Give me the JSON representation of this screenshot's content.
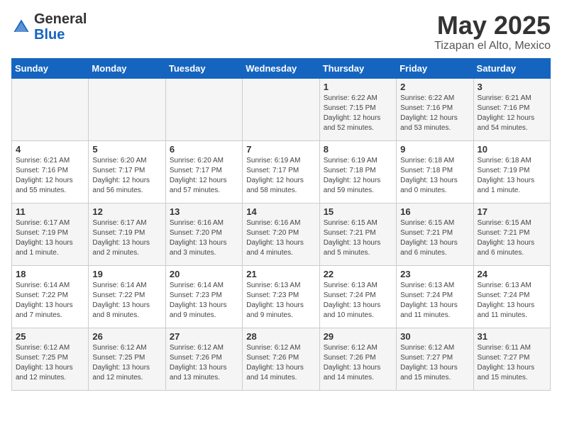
{
  "header": {
    "logo_general": "General",
    "logo_blue": "Blue",
    "title": "May 2025",
    "subtitle": "Tizapan el Alto, Mexico"
  },
  "weekdays": [
    "Sunday",
    "Monday",
    "Tuesday",
    "Wednesday",
    "Thursday",
    "Friday",
    "Saturday"
  ],
  "weeks": [
    [
      {
        "day": "",
        "info": ""
      },
      {
        "day": "",
        "info": ""
      },
      {
        "day": "",
        "info": ""
      },
      {
        "day": "",
        "info": ""
      },
      {
        "day": "1",
        "info": "Sunrise: 6:22 AM\nSunset: 7:15 PM\nDaylight: 12 hours and 52 minutes."
      },
      {
        "day": "2",
        "info": "Sunrise: 6:22 AM\nSunset: 7:16 PM\nDaylight: 12 hours and 53 minutes."
      },
      {
        "day": "3",
        "info": "Sunrise: 6:21 AM\nSunset: 7:16 PM\nDaylight: 12 hours and 54 minutes."
      }
    ],
    [
      {
        "day": "4",
        "info": "Sunrise: 6:21 AM\nSunset: 7:16 PM\nDaylight: 12 hours and 55 minutes."
      },
      {
        "day": "5",
        "info": "Sunrise: 6:20 AM\nSunset: 7:17 PM\nDaylight: 12 hours and 56 minutes."
      },
      {
        "day": "6",
        "info": "Sunrise: 6:20 AM\nSunset: 7:17 PM\nDaylight: 12 hours and 57 minutes."
      },
      {
        "day": "7",
        "info": "Sunrise: 6:19 AM\nSunset: 7:17 PM\nDaylight: 12 hours and 58 minutes."
      },
      {
        "day": "8",
        "info": "Sunrise: 6:19 AM\nSunset: 7:18 PM\nDaylight: 12 hours and 59 minutes."
      },
      {
        "day": "9",
        "info": "Sunrise: 6:18 AM\nSunset: 7:18 PM\nDaylight: 13 hours and 0 minutes."
      },
      {
        "day": "10",
        "info": "Sunrise: 6:18 AM\nSunset: 7:19 PM\nDaylight: 13 hours and 1 minute."
      }
    ],
    [
      {
        "day": "11",
        "info": "Sunrise: 6:17 AM\nSunset: 7:19 PM\nDaylight: 13 hours and 1 minute."
      },
      {
        "day": "12",
        "info": "Sunrise: 6:17 AM\nSunset: 7:19 PM\nDaylight: 13 hours and 2 minutes."
      },
      {
        "day": "13",
        "info": "Sunrise: 6:16 AM\nSunset: 7:20 PM\nDaylight: 13 hours and 3 minutes."
      },
      {
        "day": "14",
        "info": "Sunrise: 6:16 AM\nSunset: 7:20 PM\nDaylight: 13 hours and 4 minutes."
      },
      {
        "day": "15",
        "info": "Sunrise: 6:15 AM\nSunset: 7:21 PM\nDaylight: 13 hours and 5 minutes."
      },
      {
        "day": "16",
        "info": "Sunrise: 6:15 AM\nSunset: 7:21 PM\nDaylight: 13 hours and 6 minutes."
      },
      {
        "day": "17",
        "info": "Sunrise: 6:15 AM\nSunset: 7:21 PM\nDaylight: 13 hours and 6 minutes."
      }
    ],
    [
      {
        "day": "18",
        "info": "Sunrise: 6:14 AM\nSunset: 7:22 PM\nDaylight: 13 hours and 7 minutes."
      },
      {
        "day": "19",
        "info": "Sunrise: 6:14 AM\nSunset: 7:22 PM\nDaylight: 13 hours and 8 minutes."
      },
      {
        "day": "20",
        "info": "Sunrise: 6:14 AM\nSunset: 7:23 PM\nDaylight: 13 hours and 9 minutes."
      },
      {
        "day": "21",
        "info": "Sunrise: 6:13 AM\nSunset: 7:23 PM\nDaylight: 13 hours and 9 minutes."
      },
      {
        "day": "22",
        "info": "Sunrise: 6:13 AM\nSunset: 7:24 PM\nDaylight: 13 hours and 10 minutes."
      },
      {
        "day": "23",
        "info": "Sunrise: 6:13 AM\nSunset: 7:24 PM\nDaylight: 13 hours and 11 minutes."
      },
      {
        "day": "24",
        "info": "Sunrise: 6:13 AM\nSunset: 7:24 PM\nDaylight: 13 hours and 11 minutes."
      }
    ],
    [
      {
        "day": "25",
        "info": "Sunrise: 6:12 AM\nSunset: 7:25 PM\nDaylight: 13 hours and 12 minutes."
      },
      {
        "day": "26",
        "info": "Sunrise: 6:12 AM\nSunset: 7:25 PM\nDaylight: 13 hours and 12 minutes."
      },
      {
        "day": "27",
        "info": "Sunrise: 6:12 AM\nSunset: 7:26 PM\nDaylight: 13 hours and 13 minutes."
      },
      {
        "day": "28",
        "info": "Sunrise: 6:12 AM\nSunset: 7:26 PM\nDaylight: 13 hours and 14 minutes."
      },
      {
        "day": "29",
        "info": "Sunrise: 6:12 AM\nSunset: 7:26 PM\nDaylight: 13 hours and 14 minutes."
      },
      {
        "day": "30",
        "info": "Sunrise: 6:12 AM\nSunset: 7:27 PM\nDaylight: 13 hours and 15 minutes."
      },
      {
        "day": "31",
        "info": "Sunrise: 6:11 AM\nSunset: 7:27 PM\nDaylight: 13 hours and 15 minutes."
      }
    ]
  ]
}
